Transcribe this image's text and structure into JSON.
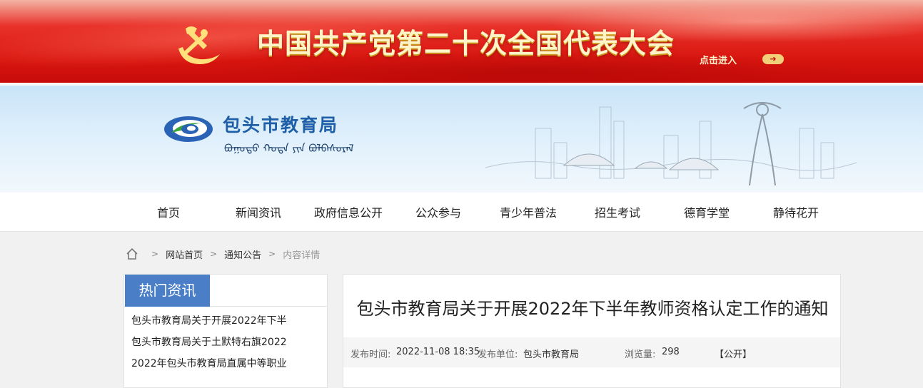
{
  "banner": {
    "title": "中国共产党第二十次全国代表大会",
    "enter_label": "点击进入",
    "enter_arrow": "➜"
  },
  "header": {
    "site_name": "包头市教育局",
    "mongolian_name": "ᠪᠤᠭᠤᠲᠤ ᠬᠣᠲᠠ ᠶᠢᠨ ᠪᠣᠯᠪᠠᠰᠤᠷᠠᠯ"
  },
  "nav": {
    "items": [
      {
        "label": "首页"
      },
      {
        "label": "新闻资讯"
      },
      {
        "label": "政府信息公开"
      },
      {
        "label": "公众参与"
      },
      {
        "label": "青少年普法"
      },
      {
        "label": "招生考试"
      },
      {
        "label": "德育学堂"
      },
      {
        "label": "静待花开"
      }
    ]
  },
  "breadcrumb": {
    "sep": ">",
    "items": [
      "网站首页",
      "通知公告",
      "内容详情"
    ]
  },
  "sidebar": {
    "title": "热门资讯",
    "items": [
      "包头市教育局关于开展2022年下半",
      "包头市教育局关于土默特右旗2022",
      "2022年包头市教育局直属中等职业"
    ]
  },
  "article": {
    "title": "包头市教育局关于开展2022年下半年教师资格认定工作的通知",
    "meta": {
      "date_label": "发布时间:",
      "date": "2022-11-08 18:35",
      "unit_label": "发布单位:",
      "unit": "包头市教育局",
      "views_label": "浏览量:",
      "views": "298",
      "status": "【公开】"
    }
  },
  "colors": {
    "banner_red": "#d8150f",
    "brand_blue": "#1f5fa8",
    "tag_blue": "#4a7fc8"
  }
}
